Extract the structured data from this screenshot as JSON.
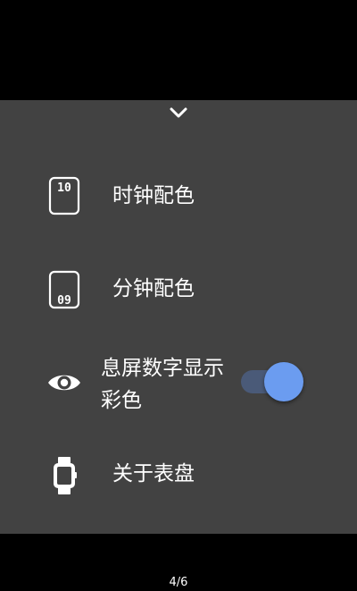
{
  "menu": {
    "items": [
      {
        "icon": "hour-digits-icon",
        "label": "时钟配色"
      },
      {
        "icon": "minute-digits-icon",
        "label": "分钟配色"
      },
      {
        "icon": "eye-icon",
        "label": "息屏数字显示彩色",
        "toggle_on": true
      },
      {
        "icon": "watch-icon",
        "label": "关于表盘"
      }
    ]
  },
  "icons": {
    "hour_digits": "10",
    "minute_digits": "09"
  },
  "colors": {
    "background": "#000000",
    "sheet": "#424242",
    "accent": "#6b9cf0",
    "toggle_track": "#4a5a78",
    "text": "#ffffff"
  },
  "pager": {
    "label": "4/6"
  }
}
